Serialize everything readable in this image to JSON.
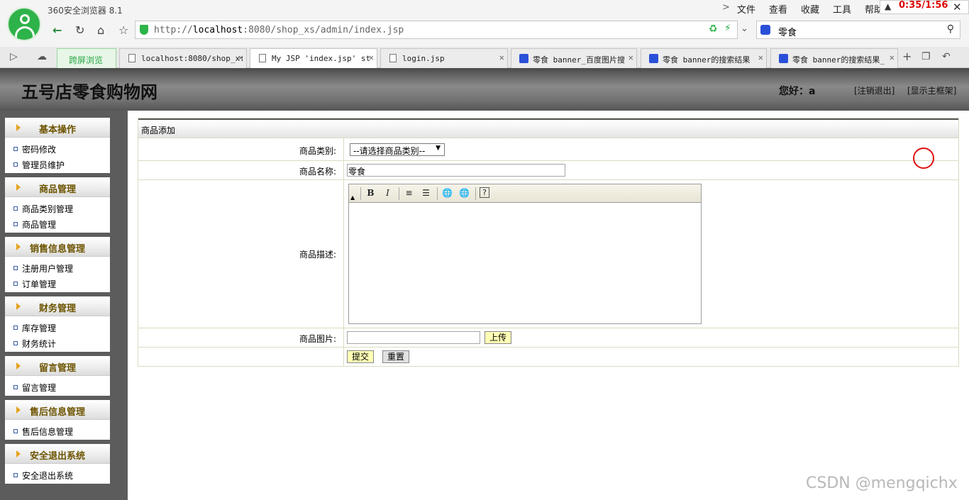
{
  "browser": {
    "title": "360安全浏览器 8.1",
    "menus": [
      "文件",
      "查看",
      "收藏",
      "工具",
      "帮助"
    ],
    "clock": "0:35/1:56",
    "address": {
      "prefix": "http://",
      "host": "localhost",
      "rest": ":8080/shop_xs/admin/index.jsp"
    },
    "search_query": "零食",
    "tabs": [
      {
        "label": "跨屏浏览",
        "type": "green"
      },
      {
        "label": "localhost:8080/shop_x:",
        "type": "doc"
      },
      {
        "label": "My JSP 'index.jsp' st",
        "type": "doc",
        "active": true
      },
      {
        "label": "login.jsp",
        "type": "doc"
      },
      {
        "label": "零食 banner_百度图片搜",
        "type": "paw"
      },
      {
        "label": "零食 banner的搜索结果",
        "type": "paw"
      },
      {
        "label": "零食 banner的搜索结果_",
        "type": "paw"
      }
    ]
  },
  "header": {
    "site_title": "五号店零食购物网",
    "welcome": "您好：a",
    "logout": "[注销退出]",
    "show_frame": "[显示主框架]"
  },
  "sidebar": {
    "groups": [
      {
        "title": "基本操作",
        "items": [
          "密码修改",
          "管理员维护"
        ]
      },
      {
        "title": "商品管理",
        "items": [
          "商品类别管理",
          "商品管理"
        ]
      },
      {
        "title": "销售信息管理",
        "items": [
          "注册用户管理",
          "订单管理"
        ]
      },
      {
        "title": "财务管理",
        "items": [
          "库存管理",
          "财务统计"
        ]
      },
      {
        "title": "留言管理",
        "items": [
          "留言管理"
        ]
      },
      {
        "title": "售后信息管理",
        "items": [
          "售后信息管理"
        ]
      },
      {
        "title": "安全退出系统",
        "items": [
          "安全退出系统"
        ]
      }
    ]
  },
  "form": {
    "heading": "商品添加",
    "category_label": "商品类别:",
    "category_selected": "--请选择商品类别--",
    "name_label": "商品名称:",
    "name_value": "零食",
    "desc_label": "商品描述:",
    "image_label": "商品图片:",
    "image_value": "",
    "upload": "上传",
    "submit": "提交",
    "reset": "重置"
  },
  "watermark": "CSDN @mengqichx",
  "colors": {
    "sidebar_bg": "#5c5c5c",
    "group_title": "#6d5400",
    "button_yellow": "#ffffb6",
    "clock": "#dd0000"
  }
}
